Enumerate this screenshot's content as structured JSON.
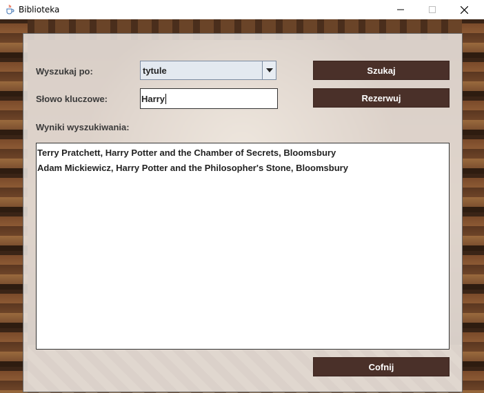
{
  "window": {
    "title": "Biblioteka",
    "app_icon": "java-cup-icon"
  },
  "form": {
    "search_by_label": "Wyszukaj po:",
    "keyword_label": "Słowo kluczowe:",
    "results_label": "Wyniki wyszukiwania:",
    "search_by_value": "tytule",
    "keyword_value": "Harry"
  },
  "buttons": {
    "search": "Szukaj",
    "reserve": "Rezerwuj",
    "back": "Cofnij"
  },
  "results": [
    "Terry Pratchett, Harry Potter and the Chamber of Secrets, Bloomsbury",
    "Adam Mickiewicz, Harry Potter and the Philosopher's Stone, Bloomsbury"
  ],
  "colors": {
    "button_bg": "#4a3029",
    "button_text": "#ffffff",
    "panel_bg": "#ece6e2"
  }
}
